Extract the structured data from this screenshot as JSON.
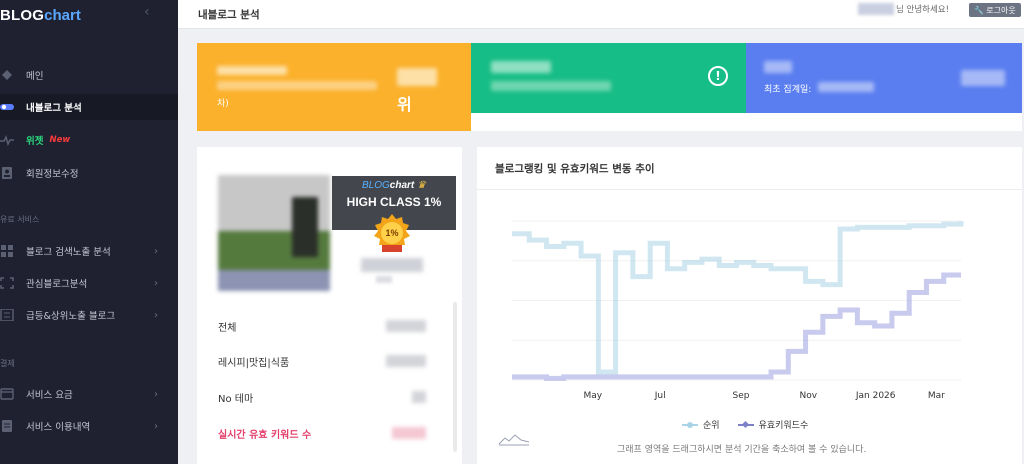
{
  "sidebar": {
    "logo_blog": "BLOG",
    "logo_chart": "chart",
    "collapse_icon": "chevron-left-icon",
    "items": [
      {
        "label": "메인",
        "icon": "diamond-icon"
      },
      {
        "label": "내블로그 분석",
        "icon": "toggle-icon",
        "active": true
      },
      {
        "label": "위젯",
        "icon": "pulse-icon",
        "badge": "New"
      },
      {
        "label": "회원정보수정",
        "icon": "user-card-icon"
      }
    ],
    "section_paid": "유료 서비스",
    "paid_items": [
      {
        "label": "블로그 검색노출 분석",
        "icon": "grid-icon"
      },
      {
        "label": "관심블로그분석",
        "icon": "frame-icon"
      },
      {
        "label": "급등&상위노출 블로그",
        "icon": "list-icon"
      }
    ],
    "section_payment": "결제",
    "payment_items": [
      {
        "label": "서비스 요금",
        "icon": "receipt-icon"
      },
      {
        "label": "서비스 이용내역",
        "icon": "history-icon"
      }
    ]
  },
  "topbar": {
    "title": "내블로그 분석",
    "greeting": "님 안녕하세요!",
    "logout": "로그아웃"
  },
  "cards": {
    "orange_suffix": "차)",
    "orange_rank_unit": "위",
    "blue_first_label": "최초 집계일:"
  },
  "profile": {
    "badge_logo_blog": "BLOG",
    "badge_logo_chart": "chart",
    "badge_text": "HIGH CLASS 1%",
    "medal_text": "1%",
    "stats": [
      {
        "label": "전체"
      },
      {
        "label": "레시피|맛집|식품"
      },
      {
        "label": "No 테마"
      },
      {
        "label": "실시간 유효 키워드 수",
        "highlight": true
      }
    ]
  },
  "chart": {
    "title": "블로그랭킹 및 유효키워드 변동 추이",
    "legend_rank": "순위",
    "legend_keywords": "유효키워드수",
    "hint": "그래프 영역을 드래그하시면 분석 기간을 축소하여 볼 수 있습니다.",
    "colors": {
      "rank": "#a9d4e6",
      "keywords": "#9b9fe0"
    }
  },
  "chart_data": {
    "type": "line",
    "title": "블로그랭킹 및 유효키워드 변동 추이",
    "x_ticks": [
      "May",
      "Jul",
      "Sep",
      "Nov",
      "Jan 2026",
      "Mar"
    ],
    "grid": true,
    "legend_position": "bottom",
    "series": [
      {
        "name": "순위",
        "color": "#a9d4e6",
        "y_fraction": [
          0.92,
          0.88,
          0.84,
          0.86,
          0.78,
          0.05,
          0.8,
          0.65,
          0.86,
          0.7,
          0.74,
          0.76,
          0.72,
          0.74,
          0.72,
          0.7,
          0.7,
          0.62,
          0.6,
          0.95,
          0.96,
          0.96,
          0.96,
          0.97,
          0.97,
          0.98,
          1.0
        ]
      },
      {
        "name": "유효키워드수",
        "color": "#9b9fe0",
        "y_fraction": [
          0.02,
          0.02,
          0.01,
          0.02,
          0.02,
          0.02,
          0.02,
          0.02,
          0.02,
          0.02,
          0.02,
          0.02,
          0.02,
          0.02,
          0.02,
          0.05,
          0.18,
          0.3,
          0.4,
          0.44,
          0.36,
          0.34,
          0.42,
          0.55,
          0.62,
          0.66,
          0.66
        ]
      }
    ]
  }
}
